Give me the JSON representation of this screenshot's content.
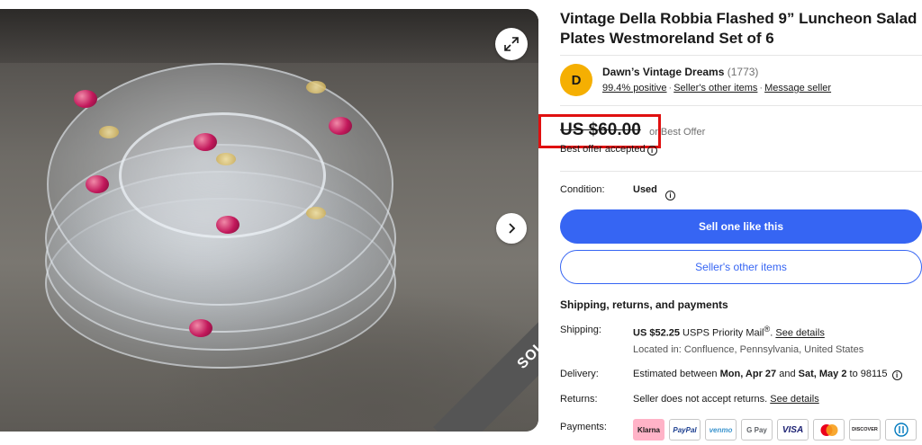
{
  "listing": {
    "title": "Vintage Della Robbia Flashed 9” Luncheon Salad Plates Westmoreland Set of 6",
    "sold_banner": "SOLD"
  },
  "seller": {
    "initial": "D",
    "name": "Dawn’s Vintage Dreams",
    "count": "(1773)",
    "positive": "99.4% positive",
    "other_items": "Seller's other items",
    "message": "Message seller"
  },
  "price": {
    "amount": "US $60.00",
    "or_best_offer": "or Best Offer",
    "offer_status": "Best offer accepted"
  },
  "condition": {
    "label": "Condition:",
    "value": "Used"
  },
  "buttons": {
    "sell_one": "Sell one like this",
    "sellers_other": "Seller's other items"
  },
  "shipping": {
    "heading": "Shipping, returns, and payments",
    "shipping_label": "Shipping:",
    "shipping_cost": "US $52.25",
    "shipping_service": " USPS Priority Mail",
    "reg_mark": "®",
    "see_details": "See details",
    "location": "Located in: Confluence, Pennsylvania, United States",
    "delivery_label": "Delivery:",
    "delivery_prefix": "Estimated between ",
    "delivery_start": "Mon, Apr 27",
    "delivery_and": " and ",
    "delivery_end": "Sat, May 2",
    "delivery_suffix": " to 98115",
    "returns_label": "Returns:",
    "returns_value": "Seller does not accept returns.",
    "returns_link": "See details",
    "payments_label": "Payments:"
  },
  "payments": [
    "Klarna",
    "PayPal",
    "venmo",
    "G Pay",
    "VISA",
    "",
    "DISCOVER",
    ""
  ],
  "colors": {
    "primary": "#3665f3",
    "avatar": "#f5af02",
    "highlight_box": "#e01010",
    "klarna": "#ffb3c7"
  }
}
